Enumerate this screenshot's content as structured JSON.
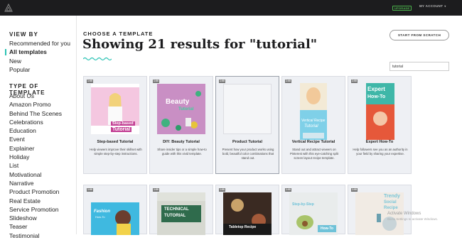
{
  "topbar": {
    "upgrade_label": "UPGRADE",
    "account_label": "MY ACCOUNT"
  },
  "sidebar": {
    "view_by_heading": "VIEW BY",
    "view_by_items": [
      "Recommended for you",
      "All templates",
      "New",
      "Popular"
    ],
    "active_item": "All templates",
    "type_heading": "TYPE OF TEMPLATE",
    "type_items": [
      "About Us",
      "Amazon Promo",
      "Behind The Scenes",
      "Celebrations",
      "Education",
      "Event",
      "Explainer",
      "Holiday",
      "List",
      "Motivational",
      "Narrative",
      "Product Promotion",
      "Real Estate",
      "Service Promotion",
      "Slideshow",
      "Teaser",
      "Testimonial"
    ]
  },
  "main": {
    "kicker": "CHOOSE A TEMPLATE",
    "title": "Showing 21 results for \"tutorial\"",
    "start_button": "START FROM SCRATCH",
    "search_value": "tutorial"
  },
  "cards": [
    {
      "badge": "1:00",
      "name": "Step-based Tutorial",
      "desc": "Help viewers improve their skillset with simple step-by-step instructions.",
      "thumb_text": [
        "Step-based",
        "Tutorial"
      ]
    },
    {
      "badge": "1:00",
      "name": "DIY: Beauty Tutorial",
      "desc": "Share insider tips or a simple how-to guide with this vivid template.",
      "thumb_text": [
        "Beauty",
        "Tutorial"
      ]
    },
    {
      "badge": "1:00",
      "name": "Product Tutorial",
      "desc": "Present how your product works using bold, beautiful color combinations that stand out."
    },
    {
      "badge": "1:00",
      "name": "Vertical Recipe Tutorial",
      "desc": "Stand out and attract viewers on Pinterest with this eye-catching split screen layout recipe template.",
      "thumb_text": [
        "Vertical Recipe",
        "Tutorial"
      ]
    },
    {
      "badge": "1:00",
      "name": "Expert How-To",
      "desc": "Help followers see you as an authority in your field by sharing your expertise.",
      "thumb_text": [
        "Expert",
        "How-To"
      ]
    },
    {
      "badge": "1:00",
      "thumb_text": [
        "Fashion",
        "How-To"
      ]
    },
    {
      "badge": "1:00",
      "thumb_text": [
        "TECHNICAL",
        "TUTORIAL"
      ]
    },
    {
      "badge": "1:00",
      "thumb_text": [
        "Tabletop Recipe"
      ]
    },
    {
      "badge": "1:00",
      "thumb_text": [
        "Step-by-Step",
        "How-To"
      ]
    },
    {
      "badge": "1:00",
      "thumb_text": [
        "Trendy",
        "Social",
        "Recipe"
      ]
    }
  ],
  "watermark": {
    "line1": "Activate Windows",
    "line2": "Go to Settings to activate Windows."
  },
  "colors": {
    "accent": "#2bc3b4",
    "topbar": "#1c1c1e",
    "upgrade": "#4cb44c",
    "card_bg": "#eef0f4"
  }
}
